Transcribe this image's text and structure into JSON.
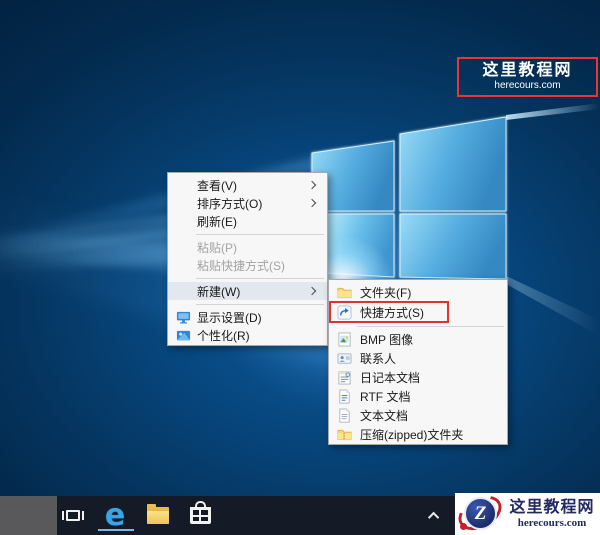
{
  "context_menu": {
    "items": [
      {
        "label": "查看(V)",
        "has_submenu_arrow": true,
        "state": "normal"
      },
      {
        "label": "排序方式(O)",
        "has_submenu_arrow": true,
        "state": "normal"
      },
      {
        "label": "刷新(E)",
        "has_submenu_arrow": false,
        "state": "normal"
      },
      {
        "label": "粘贴(P)",
        "has_submenu_arrow": false,
        "state": "disabled"
      },
      {
        "label": "粘贴快捷方式(S)",
        "has_submenu_arrow": false,
        "state": "disabled"
      },
      {
        "label": "新建(W)",
        "has_submenu_arrow": true,
        "state": "highlighted-open"
      },
      {
        "label": "显示设置(D)",
        "icon": "display-settings-icon",
        "state": "normal"
      },
      {
        "label": "个性化(R)",
        "icon": "personalize-icon",
        "state": "normal"
      }
    ]
  },
  "new_submenu": {
    "items": [
      {
        "label": "文件夹(F)",
        "icon": "folder-icon"
      },
      {
        "label": "快捷方式(S)",
        "icon": "shortcut-icon",
        "marked_with_red_box": true
      },
      {
        "label": "BMP 图像",
        "icon": "bmp-image-icon"
      },
      {
        "label": "联系人",
        "icon": "contact-icon"
      },
      {
        "label": "日记本文档",
        "icon": "journal-doc-icon"
      },
      {
        "label": "RTF 文档",
        "icon": "rtf-doc-icon"
      },
      {
        "label": "文本文档",
        "icon": "text-doc-icon"
      },
      {
        "label": "压缩(zipped)文件夹",
        "icon": "zip-folder-icon"
      }
    ]
  },
  "taskbar": {
    "edge_glyph": "e",
    "buttons": [
      "task-view",
      "microsoft-edge",
      "file-explorer",
      "store"
    ],
    "edge_active": true
  },
  "watermark_top": {
    "title": "这里教程网",
    "domain": "herecours.com"
  },
  "watermark_bottom": {
    "title": "这里教程网",
    "domain": "herecours.com",
    "logo_letter": "Z"
  },
  "colors": {
    "wallpaper_navy": "#053763",
    "logo_pane_blue": "#54acdf",
    "menu_bg": "#f7f7f7",
    "menu_highlight": "#e2e8ee",
    "red_box": "#e03232",
    "taskbar_bg": "#151a27",
    "edge_blue": "#3aa5e6",
    "watermark_red": "#c3222b",
    "watermark_navy": "#222a60"
  }
}
